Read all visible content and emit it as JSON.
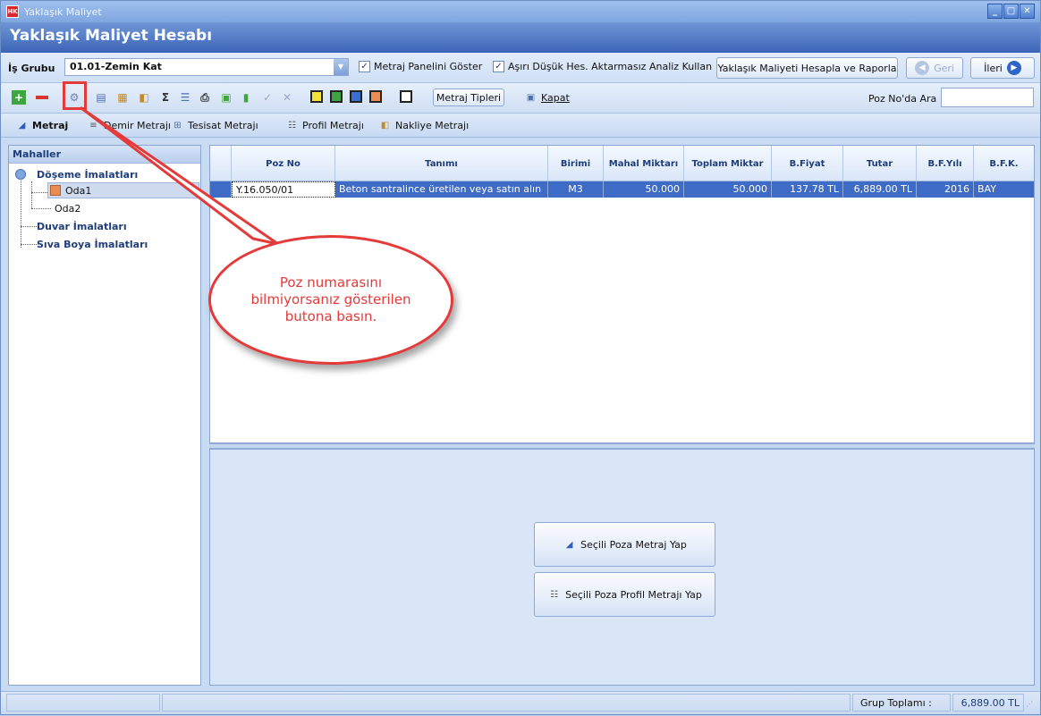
{
  "window": {
    "title": "Yaklaşık Maliyet",
    "app_icon": "HK"
  },
  "banner": {
    "title": "Yaklaşık Maliyet Hesabı"
  },
  "is_grubu": {
    "label": "İş Grubu",
    "value": "01.01-Zemin Kat"
  },
  "options": {
    "show_metraj_panel": "Metraj Panelini Göster",
    "low_analysis": "Aşırı Düşük Hes. Aktarmasız Analiz Kullan"
  },
  "actions": {
    "calculate": "Yaklaşık Maliyeti Hesapla ve Raporla",
    "back": "Geri",
    "next": "İleri"
  },
  "toolbar": {
    "metraj_types": "Metraj Tipleri",
    "close": "Kapat",
    "search_label": "Poz No'da Ara",
    "search_value": ""
  },
  "tabs": [
    "Metraj",
    "Demir Metrajı",
    "Tesisat Metrajı",
    "Profil Metrajı",
    "Nakliye Metrajı"
  ],
  "tree": {
    "header": "Mahaller",
    "group1": "Döşeme İmalatları",
    "room1": "Oda1",
    "room2": "Oda2",
    "group2": "Duvar İmalatları",
    "group3": "Sıva Boya İmalatları"
  },
  "grid": {
    "columns": [
      "Poz No",
      "Tanımı",
      "Birimi",
      "Mahal Miktarı",
      "Toplam Miktar",
      "B.Fiyat",
      "Tutar",
      "B.F.Yılı",
      "B.F.K."
    ],
    "rows": [
      [
        "Y.16.050/01",
        "Beton santralince üretilen veya satın alın",
        "M3",
        "50.000",
        "50.000",
        "137.78 TL",
        "6,889.00 TL",
        "2016",
        "BAY"
      ]
    ]
  },
  "bottom": {
    "btn1": "Seçili Poza Metraj Yap",
    "btn2": "Seçili Poza Profil Metrajı Yap"
  },
  "status": {
    "label": "Grup Toplamı :",
    "value": "6,889.00 TL"
  },
  "annotation": {
    "text": "Poz numarasını bilmiyorsanız gösterilen butona basın.",
    "color": "#e43a3a"
  }
}
